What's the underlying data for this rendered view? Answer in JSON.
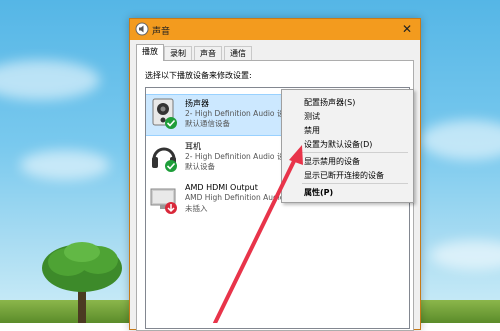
{
  "window": {
    "title": "声音",
    "close_glyph": "✕"
  },
  "tabs": [
    {
      "label": "播放",
      "active": true
    },
    {
      "label": "录制",
      "active": false
    },
    {
      "label": "声音",
      "active": false
    },
    {
      "label": "通信",
      "active": false
    }
  ],
  "panel": {
    "hint": "选择以下播放设备来修改设置:"
  },
  "devices": [
    {
      "name": "扬声器",
      "description": "2- High Definition Audio 设",
      "status": "默认通信设备",
      "icon": "speaker-icon",
      "badge": "green-check-phone-icon",
      "selected": true
    },
    {
      "name": "耳机",
      "description": "2- High Definition Audio 设",
      "status": "默认设备",
      "icon": "headphones-icon",
      "badge": "green-check-icon",
      "selected": false
    },
    {
      "name": "AMD HDMI Output",
      "description": "AMD High Definition Audio",
      "status": "未插入",
      "icon": "monitor-icon",
      "badge": "red-down-arrow-icon",
      "selected": false
    }
  ],
  "context_menu": {
    "items": [
      {
        "label": "配置扬声器(S)"
      },
      {
        "label": "测试"
      },
      {
        "label": "禁用"
      },
      {
        "label": "设置为默认设备(D)"
      },
      {
        "label": "显示禁用的设备"
      },
      {
        "label": "显示已断开连接的设备"
      },
      {
        "label": "属性(P)",
        "bold": true
      }
    ]
  },
  "colors": {
    "titlebar": "#f39b1e",
    "selection": "#cce8ff",
    "arrow": "#e8344a",
    "check": "#1e9e3a"
  }
}
